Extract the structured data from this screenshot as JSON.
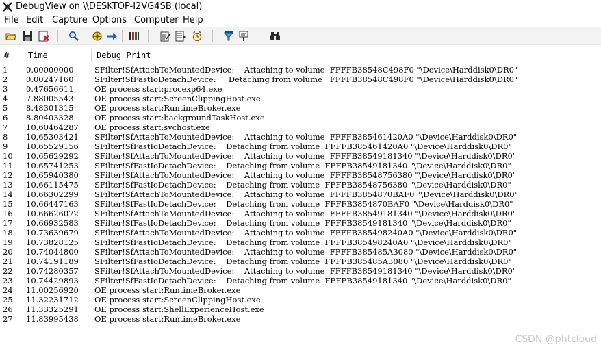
{
  "window": {
    "title": "DebugView on \\\\DESKTOP-I2VG4SB (local)"
  },
  "menu": [
    "File",
    "Edit",
    "Capture",
    "Options",
    "Computer",
    "Help"
  ],
  "toolbar": {
    "buttons": [
      "open-icon",
      "save-icon",
      "clear-display-icon",
      "find-icon",
      "capture-icon",
      "autoscroll-icon",
      "clock-time-icon",
      "edit-filter-icon",
      "history-icon",
      "timer-icon",
      "highlight-icon",
      "filter-icon",
      "find-binoculars-icon"
    ]
  },
  "columns": {
    "num": "#",
    "time": "Time",
    "message": "Debug Print"
  },
  "rows": [
    {
      "num": "1",
      "time": "0.00000000",
      "msg": "SFilter!SfAttachToMountedDevice:    Attaching to volume  FFFFB38548C498F0 \"\\Device\\Harddisk0\\DR0\""
    },
    {
      "num": "2",
      "time": "0.00247160",
      "msg": "SFilter!SfFastIoDetachDevice:     Detaching from volume   FFFFB38548C498F0 \"\\Device\\Harddisk0\\DR0\""
    },
    {
      "num": "3",
      "time": "0.47656611",
      "msg": "OE process start:procexp64.exe"
    },
    {
      "num": "4",
      "time": "7.88005543",
      "msg": "OE process start:ScreenClippingHost.exe"
    },
    {
      "num": "5",
      "time": "8.48301315",
      "msg": "OE process start:RuntimeBroker.exe"
    },
    {
      "num": "6",
      "time": "8.80403328",
      "msg": "OE process start:backgroundTaskHost.exe"
    },
    {
      "num": "7",
      "time": "10.60464287",
      "msg": "OE process start:svchost.exe"
    },
    {
      "num": "8",
      "time": "10.65303421",
      "msg": "SFilter!SfAttachToMountedDevice:    Attaching to volume  FFFFB385461420A0 \"\\Device\\Harddisk0\\DR0\""
    },
    {
      "num": "9",
      "time": "10.65529156",
      "msg": "SFilter!SfFastIoDetachDevice:    Detaching from volume  FFFFB385461420A0 \"\\Device\\Harddisk0\\DR0\""
    },
    {
      "num": "10",
      "time": "10.65629292",
      "msg": "SFilter!SfAttachToMountedDevice:    Attaching to volume  FFFFB38549181340 \"\\Device\\Harddisk0\\DR0\""
    },
    {
      "num": "11",
      "time": "10.65741253",
      "msg": "SFilter!SfFastIoDetachDevice:    Detaching from volume  FFFFB38549181340 \"\\Device\\Harddisk0\\DR0\""
    },
    {
      "num": "12",
      "time": "10.65940380",
      "msg": "SFilter!SfAttachToMountedDevice:    Attaching to volume  FFFFB38548756380 \"\\Device\\Harddisk0\\DR0\""
    },
    {
      "num": "13",
      "time": "10.66115475",
      "msg": "SFilter!SfFastIoDetachDevice:    Detaching from volume  FFFFB38548756380 \"\\Device\\Harddisk0\\DR0\""
    },
    {
      "num": "14",
      "time": "10.66302299",
      "msg": "SFilter!SfAttachToMountedDevice:    Attaching to volume  FFFFB3854870BAF0 \"\\Device\\Harddisk0\\DR0\""
    },
    {
      "num": "15",
      "time": "10.66447163",
      "msg": "SFilter!SfFastIoDetachDevice:    Detaching from volume  FFFFB3854870BAF0 \"\\Device\\Harddisk0\\DR0\""
    },
    {
      "num": "16",
      "time": "10.66626072",
      "msg": "SFilter!SfAttachToMountedDevice:    Attaching to volume  FFFFB38549181340 \"\\Device\\Harddisk0\\DR0\""
    },
    {
      "num": "17",
      "time": "10.66932583",
      "msg": "SFilter!SfFastIoDetachDevice:    Detaching from volume  FFFFB38549181340 \"\\Device\\Harddisk0\\DR0\""
    },
    {
      "num": "18",
      "time": "10.73639679",
      "msg": "SFilter!SfAttachToMountedDevice:    Attaching to volume  FFFFB385498240A0 \"\\Device\\Harddisk0\\DR0\""
    },
    {
      "num": "19",
      "time": "10.73828125",
      "msg": "SFilter!SfFastIoDetachDevice:    Detaching from volume  FFFFB385498240A0 \"\\Device\\Harddisk0\\DR0\""
    },
    {
      "num": "20",
      "time": "10.74044800",
      "msg": "SFilter!SfAttachToMountedDevice:    Attaching to volume  FFFFB385485A3080 \"\\Device\\Harddisk0\\DR0\""
    },
    {
      "num": "21",
      "time": "10.74191189",
      "msg": "SFilter!SfFastIoDetachDevice:    Detaching from volume  FFFFB385485A3080 \"\\Device\\Harddisk0\\DR0\""
    },
    {
      "num": "22",
      "time": "10.74280357",
      "msg": "SFilter!SfAttachToMountedDevice:    Attaching to volume  FFFFB38549181340 \"\\Device\\Harddisk0\\DR0\""
    },
    {
      "num": "23",
      "time": "10.74429893",
      "msg": "SFilter!SfFastIoDetachDevice:    Detaching from volume  FFFFB38549181340 \"\\Device\\Harddisk0\\DR0\""
    },
    {
      "num": "24",
      "time": "11.00256920",
      "msg": "OE process start:RuntimeBroker.exe"
    },
    {
      "num": "25",
      "time": "11.32231712",
      "msg": "OE process start:ScreenClippingHost.exe"
    },
    {
      "num": "26",
      "time": "11.33325291",
      "msg": "OE process start:ShellExperienceHost.exe"
    },
    {
      "num": "27",
      "time": "11.83995438",
      "msg": "OE process start:RuntimeBroker.exe"
    }
  ],
  "watermark": "CSDN @phtcloud"
}
